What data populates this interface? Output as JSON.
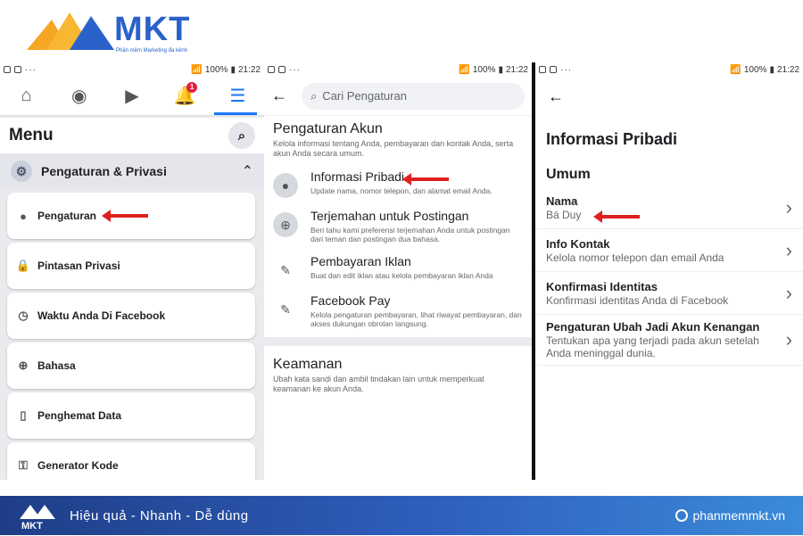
{
  "brand": {
    "name": "MKT",
    "tagline": "Phần mềm Marketing đa kênh",
    "colors": {
      "primary": "#2a62c9",
      "accent": "#f5a623"
    }
  },
  "status": {
    "left_panel": {
      "battery": "100%",
      "time": "21:22"
    },
    "mid_panel": {
      "battery": "100%",
      "time": "21:22"
    },
    "right_panel": {
      "battery": "100%",
      "time": "21:22"
    }
  },
  "panel1": {
    "tabs": [
      {
        "icon": "home-icon"
      },
      {
        "icon": "groups-icon"
      },
      {
        "icon": "watch-icon"
      },
      {
        "icon": "bell-icon",
        "badge": "1"
      },
      {
        "icon": "menu-icon",
        "active": true
      }
    ],
    "menu_title": "Menu",
    "section_label": "Pengaturan & Privasi",
    "items": [
      {
        "label": "Pengaturan",
        "icon": "user-icon",
        "highlighted": true
      },
      {
        "label": "Pintasan Privasi",
        "icon": "lock-icon"
      },
      {
        "label": "Waktu Anda Di Facebook",
        "icon": "clock-icon"
      },
      {
        "label": "Bahasa",
        "icon": "globe-icon"
      },
      {
        "label": "Penghemat Data",
        "icon": "phone-icon"
      },
      {
        "label": "Generator Kode",
        "icon": "key-icon"
      }
    ]
  },
  "panel2": {
    "search_placeholder": "Cari Pengaturan",
    "header": "Pengaturan Akun",
    "desc": "Kelola informasi tentang Anda, pembayaran dan kontak Anda, serta akun Anda secara umum.",
    "items": [
      {
        "title": "Informasi Pribadi",
        "sub": "Update nama, nomor telepon, dan alamat email Anda.",
        "icon": "user-icon",
        "highlighted": true
      },
      {
        "title": "Terjemahan untuk Postingan",
        "sub": "Beri tahu kami preferensi terjemahan Anda untuk postingan dari teman dan postingan dua bahasa.",
        "icon": "globe-icon"
      },
      {
        "title": "Pembayaran Iklan",
        "sub": "Buat dan edit iklan atau kelola pembayaran iklan Anda",
        "icon": "tag-icon"
      },
      {
        "title": "Facebook Pay",
        "sub": "Kelola pengaturan pembayaran, lihat riwayat pembayaran, dan akses dukungan obrolan langsung.",
        "icon": "tag-icon"
      }
    ],
    "security_header": "Keamanan",
    "security_desc": "Ubah kata sandi dan ambil tindakan lain untuk memperkuat keamanan ke akun Anda."
  },
  "panel3": {
    "title": "Informasi Pribadi",
    "subtitle": "Umum",
    "rows": [
      {
        "title": "Nama",
        "sub": "Bá Duy",
        "highlighted": true
      },
      {
        "title": "Info Kontak",
        "sub": "Kelola nomor telepon dan email Anda"
      },
      {
        "title": "Konfirmasi Identitas",
        "sub": "Konfirmasi identitas Anda di Facebook"
      },
      {
        "title": "Pengaturan Ubah Jadi Akun Kenangan",
        "sub": "Tentukan apa yang terjadi pada akun setelah Anda meninggal dunia."
      }
    ]
  },
  "footer": {
    "slogan": "Hiệu quả - Nhanh - Dễ dùng",
    "site": "phanmemmkt.vn"
  }
}
